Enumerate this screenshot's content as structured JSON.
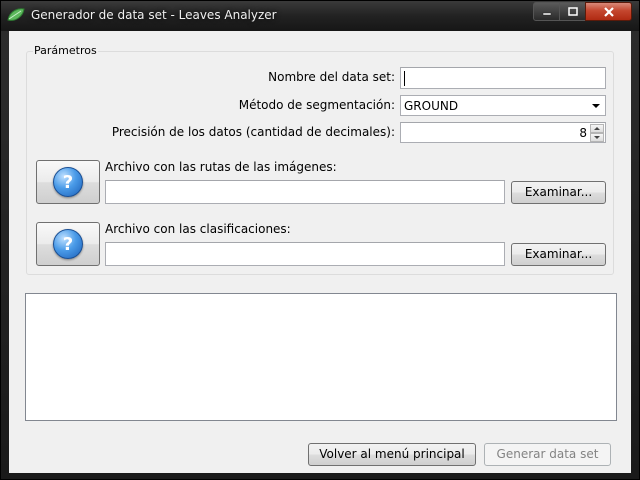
{
  "window": {
    "title": "Generador de data set - Leaves Analyzer"
  },
  "params": {
    "legend": "Parámetros",
    "name_label": "Nombre del data set:",
    "name_value": "",
    "method_label": "Método de segmentación:",
    "method_value": "GROUND",
    "precision_label": "Precisión de los datos (cantidad de decimales):",
    "precision_value": "8",
    "routes_label": "Archivo con las rutas de las imágenes:",
    "routes_value": "",
    "routes_browse": "Examinar...",
    "class_label": "Archivo con las clasificaciones:",
    "class_value": "",
    "class_browse": "Examinar..."
  },
  "footer": {
    "back_label": "Volver al menú principal",
    "generate_label": "Generar data set"
  },
  "colors": {
    "close_button": "#c4462e",
    "help_icon": "#4a9be8",
    "leaf_icon": "#4caf50"
  }
}
